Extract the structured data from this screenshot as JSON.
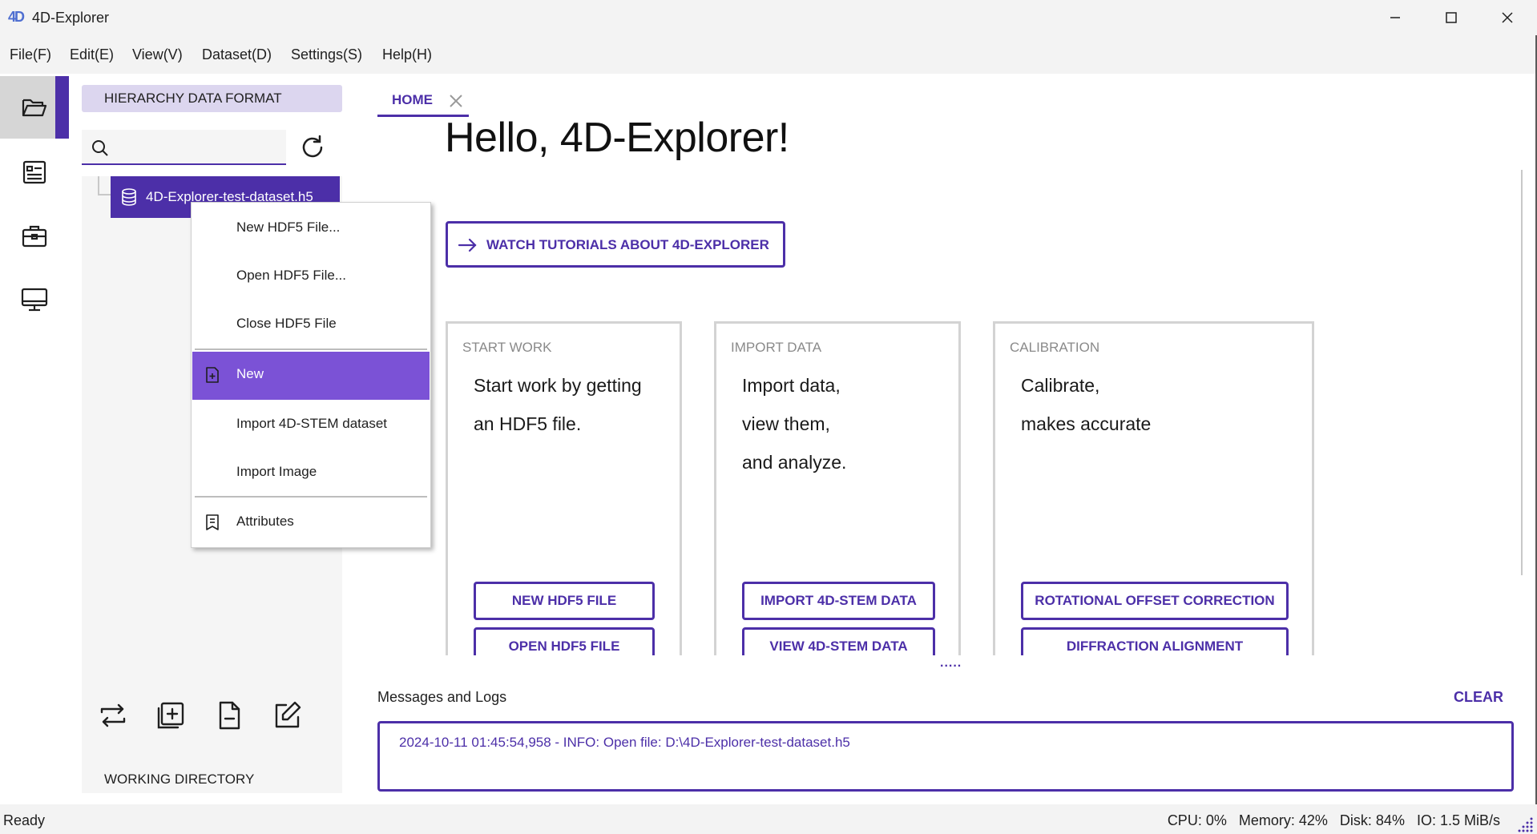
{
  "window": {
    "title": "4D-Explorer",
    "logo_text": "4D"
  },
  "menubar": [
    "File(F)",
    "Edit(E)",
    "View(V)",
    "Dataset(D)",
    "Settings(S)",
    "Help(H)"
  ],
  "rail": [
    "folder-open-icon",
    "form-icon",
    "toolbox-icon",
    "monitor-icon"
  ],
  "left_panel": {
    "header": "HIERARCHY DATA FORMAT",
    "search": {
      "value": "",
      "placeholder": ""
    },
    "tree_node": "4D-Explorer-test-dataset.h5",
    "working_directory": "WORKING DIRECTORY"
  },
  "context_menu": {
    "items": [
      {
        "label": "New HDF5 File..."
      },
      {
        "label": "Open HDF5 File..."
      },
      {
        "label": "Close HDF5 File"
      },
      {
        "label": "New",
        "selected": true,
        "icon": "new-file-icon"
      },
      {
        "label": "Import 4D-STEM dataset"
      },
      {
        "label": "Import Image"
      },
      {
        "label": "Attributes",
        "icon": "attributes-icon"
      }
    ]
  },
  "main": {
    "tab": "HOME",
    "heading": "Hello, 4D-Explorer!",
    "watch_button": "WATCH TUTORIALS ABOUT 4D-EXPLORER",
    "cards": [
      {
        "title": "START WORK",
        "lines": [
          "Start work by getting",
          "an HDF5 file."
        ],
        "buttons": [
          "NEW HDF5 FILE",
          "OPEN HDF5 FILE"
        ]
      },
      {
        "title": "IMPORT DATA",
        "lines": [
          "Import data,",
          "view them,",
          "and analyze."
        ],
        "buttons": [
          "IMPORT 4D-STEM DATA",
          "VIEW 4D-STEM DATA"
        ]
      },
      {
        "title": "CALIBRATION",
        "lines": [
          "Calibrate,",
          "makes accurate"
        ],
        "buttons": [
          "ROTATIONAL OFFSET CORRECTION",
          "DIFFRACTION ALIGNMENT"
        ]
      }
    ],
    "splitter": ".....",
    "messages_title": "Messages and Logs",
    "clear_label": "CLEAR",
    "log_lines": [
      "2024-10-11 01:45:54,958 - INFO: Open file: D:\\4D-Explorer-test-dataset.h5"
    ]
  },
  "statusbar": {
    "left": "Ready",
    "cpu": "CPU: 0%",
    "memory": "Memory: 42%",
    "disk": "Disk: 84%",
    "io": "IO: 1.5 MiB/s"
  },
  "colors": {
    "accent": "#4c2fa8",
    "menu_selected": "#7b52d6",
    "header_bg": "#dcd6ef"
  }
}
